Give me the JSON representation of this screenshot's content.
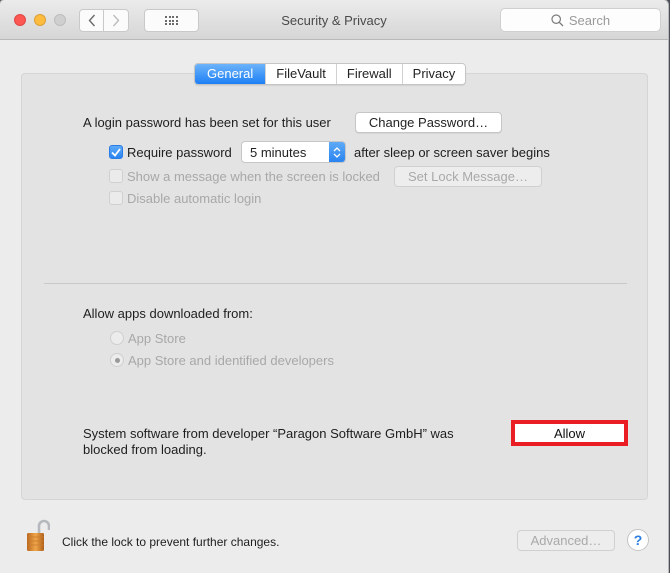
{
  "window": {
    "title": "Security & Privacy",
    "search_placeholder": "Search",
    "nav": {
      "back_icon": "chevron-left-icon",
      "forward_icon": "chevron-right-icon",
      "show_all_icon": "grid-icon"
    }
  },
  "tabs": [
    {
      "label": "General",
      "active": true
    },
    {
      "label": "FileVault",
      "active": false
    },
    {
      "label": "Firewall",
      "active": false
    },
    {
      "label": "Privacy",
      "active": false
    }
  ],
  "general": {
    "login_password_text": "A login password has been set for this user",
    "change_password_label": "Change Password…",
    "require_password": {
      "label": "Require password",
      "checked": true,
      "selected_option": "5 minutes",
      "suffix": "after sleep or screen saver begins"
    },
    "show_message": {
      "label": "Show a message when the screen is locked",
      "checked": false,
      "disabled": true,
      "button_label": "Set Lock Message…"
    },
    "disable_auto_login": {
      "label": "Disable automatic login",
      "checked": false,
      "disabled": true
    },
    "allow_apps": {
      "heading": "Allow apps downloaded from:",
      "options": [
        {
          "label": "App Store",
          "selected": false
        },
        {
          "label": "App Store and identified developers",
          "selected": true
        }
      ]
    },
    "blocked_message": {
      "line1": "System software from developer “Paragon Software GmbH” was",
      "line2": "blocked from loading.",
      "allow_label": "Allow",
      "highlight_color": "#ea1d25"
    }
  },
  "footer": {
    "lock_text": "Click the lock to prevent further changes.",
    "lock_state": "unlocked",
    "advanced_label": "Advanced…",
    "help_label": "?"
  }
}
